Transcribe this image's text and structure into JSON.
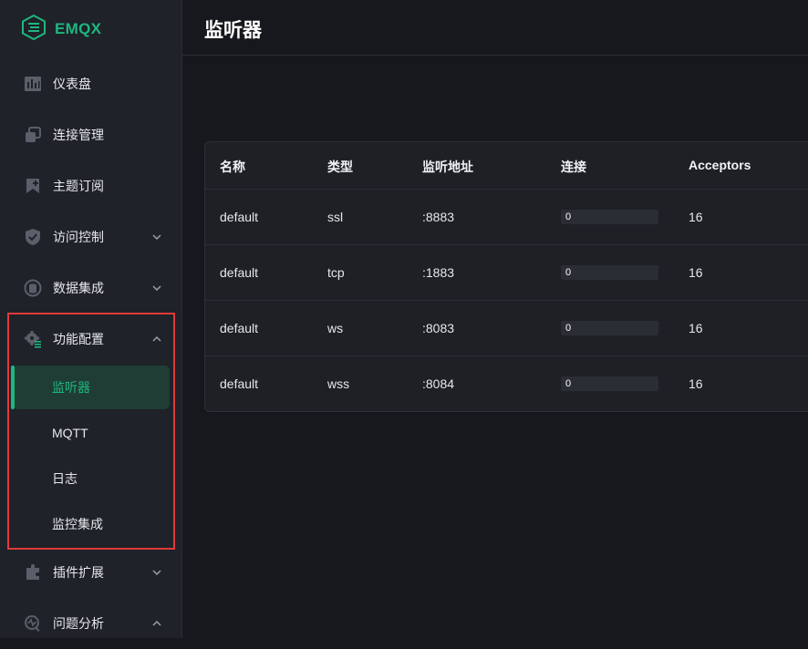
{
  "brand": {
    "name": "EMQX",
    "color": "#1fb67e"
  },
  "header": {
    "title": "监听器"
  },
  "sidebar": {
    "items": [
      {
        "label": "仪表盘",
        "icon": "dashboard-icon"
      },
      {
        "label": "连接管理",
        "icon": "connections-icon"
      },
      {
        "label": "主题订阅",
        "icon": "subscribe-icon"
      },
      {
        "label": "访问控制",
        "icon": "shield-icon",
        "chevron": "down"
      },
      {
        "label": "数据集成",
        "icon": "data-integration-icon",
        "chevron": "down"
      },
      {
        "label": "功能配置",
        "icon": "settings-icon",
        "chevron": "up"
      },
      {
        "label": "插件扩展",
        "icon": "plugin-icon",
        "chevron": "down"
      },
      {
        "label": "问题分析",
        "icon": "diagnose-icon",
        "chevron": "up"
      }
    ],
    "subitems": [
      {
        "label": "监听器",
        "active": true
      },
      {
        "label": "MQTT"
      },
      {
        "label": "日志"
      },
      {
        "label": "监控集成"
      }
    ]
  },
  "table": {
    "headers": [
      "名称",
      "类型",
      "监听地址",
      "连接",
      "Acceptors"
    ],
    "rows": [
      {
        "name": "default",
        "type": "ssl",
        "address": ":8883",
        "connections": "0",
        "connections_fraction": 0,
        "acceptors": "16"
      },
      {
        "name": "default",
        "type": "tcp",
        "address": ":1883",
        "connections": "0",
        "connections_fraction": 0,
        "acceptors": "16"
      },
      {
        "name": "default",
        "type": "ws",
        "address": ":8083",
        "connections": "0",
        "connections_fraction": 0,
        "acceptors": "16"
      },
      {
        "name": "default",
        "type": "wss",
        "address": ":8084",
        "connections": "0",
        "connections_fraction": 0,
        "acceptors": "16"
      }
    ]
  },
  "colors": {
    "accent": "#1fb67e",
    "highlight": "#e03a3a",
    "sidebar_bg": "#1f2228",
    "main_bg": "#17181d"
  }
}
